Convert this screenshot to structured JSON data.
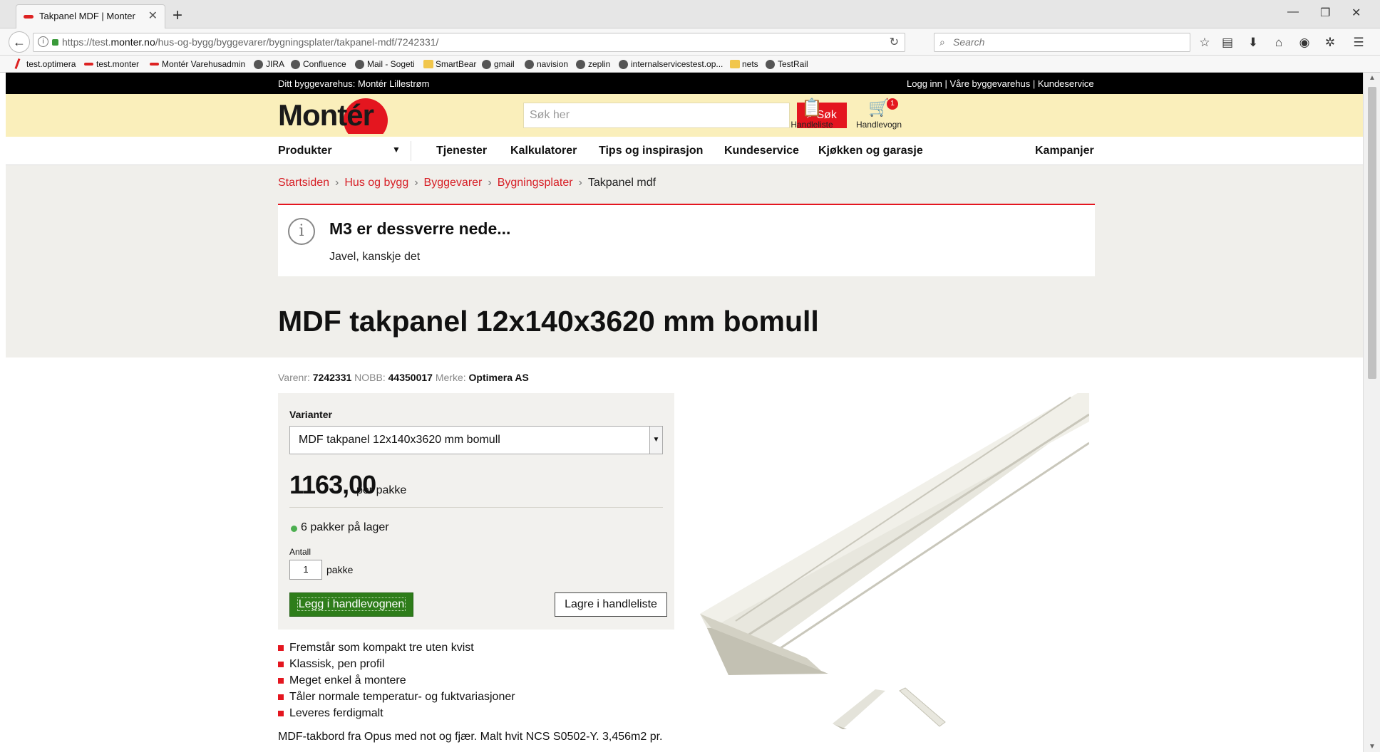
{
  "browser": {
    "tab_title": "Takpanel MDF | Monter",
    "new_tab": "+",
    "url_prefix": "https://test.",
    "url_domain": "monter.no",
    "url_path": "/hus-og-bygg/byggevarer/bygningsplater/takpanel-mdf/7242331/",
    "search_placeholder": "Search",
    "bookmarks": [
      "test.optimera",
      "test.monter",
      "Montér Varehusadmin",
      "JIRA",
      "Confluence",
      "Mail - Sogeti",
      "SmartBear",
      "gmail",
      "navision",
      "zeplin",
      "internalservicestest.op...",
      "nets",
      "TestRail"
    ]
  },
  "site": {
    "store_text": "Ditt byggevarehus: Montér Lillestrøm",
    "top_links": "Logg inn | Våre byggevarehus | Kundeservice",
    "logo_text": "Montér",
    "search_placeholder": "Søk her",
    "search_button": "Søk",
    "shopping_list": "Handleliste",
    "cart": "Handlevogn",
    "cart_count": "1",
    "nav": {
      "products": "Produkter",
      "services": "Tjenester",
      "calculators": "Kalkulatorer",
      "tips": "Tips og inspirasjon",
      "customer_service": "Kundeservice",
      "kitchen": "Kjøkken og garasje",
      "campaigns": "Kampanjer"
    }
  },
  "breadcrumb": [
    "Startsiden",
    "Hus og bygg",
    "Byggevarer",
    "Bygningsplater",
    "Takpanel mdf"
  ],
  "alert": {
    "title": "M3 er dessverre nede...",
    "message": "Javel, kanskje det"
  },
  "product": {
    "title": "MDF takpanel 12x140x3620 mm bomull",
    "varenr_label": "Varenr:",
    "varenr": "7242331",
    "nobb_label": "NOBB:",
    "nobb": "44350017",
    "brand_label": "Merke:",
    "brand": "Optimera AS",
    "variants_label": "Varianter",
    "variant_selected": "MDF takpanel 12x140x3620 mm bomull",
    "price": "1163,00",
    "price_unit": "per pakke",
    "stock": "6 pakker på lager",
    "quantity_label": "Antall",
    "quantity": "1",
    "quantity_unit": "pakke",
    "add_to_cart": "Legg i handlevognen",
    "save_to_list": "Lagre i handleliste",
    "features": [
      "Fremstår som kompakt tre uten kvist",
      "Klassisk, pen profil",
      "Meget enkel å montere",
      "Tåler normale temperatur- og fuktvariasjoner",
      "Leveres ferdigmalt"
    ],
    "description": "MDF-takbord fra Opus med not og fjær. Malt hvit NCS S0502-Y. 3,456m2 pr."
  },
  "colors": {
    "brand_red": "#e4161f",
    "header_yellow": "#faefbb",
    "cart_green": "#2e7d1a"
  }
}
